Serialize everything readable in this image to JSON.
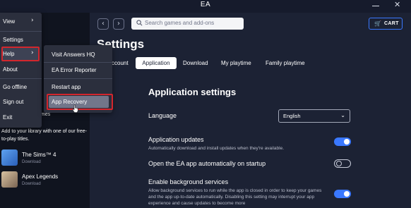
{
  "app": {
    "title": "EA",
    "close_glyph": "✕",
    "back_glyph": "‹",
    "forward_glyph": "›"
  },
  "search": {
    "placeholder": "Search games and add-ons"
  },
  "cart": {
    "label": "CART",
    "icon": "cart-icon",
    "glyph": "🛒"
  },
  "settings": {
    "title": "Settings",
    "tabs": [
      "ccount",
      "Application",
      "Download",
      "My playtime",
      "Family playtime"
    ],
    "active_tab": "Application",
    "section_title": "Application settings",
    "language": {
      "label": "Language",
      "value": "English",
      "arrow": "⌄"
    },
    "rows": [
      {
        "label": "Application updates",
        "description": "Automatically download and install updates when they're available.",
        "enabled": true
      },
      {
        "label": "Open the EA app automatically on startup",
        "description": "",
        "enabled": false
      },
      {
        "label": "Enable background services",
        "description": "Allow background services to run while the app is closed in order to keep your games and the app up-to-date automatically. Disabling this setting may interrupt your app experience and cause updates to become more",
        "enabled": true
      }
    ]
  },
  "menu": {
    "items": [
      {
        "label": "View",
        "has_arrow": true
      },
      {
        "label": "Settings",
        "has_arrow": false
      },
      {
        "label": "Help",
        "has_arrow": true
      },
      {
        "label": "About",
        "has_arrow": false
      },
      {
        "label": "Go offline",
        "has_arrow": false
      },
      {
        "label": "Sign out",
        "has_arrow": false
      },
      {
        "label": "Exit",
        "has_arrow": false
      }
    ],
    "arrow_glyph": "›"
  },
  "help_submenu": {
    "items": [
      {
        "label": "Visit Answers HQ"
      },
      {
        "label": "EA Error Reporter"
      },
      {
        "label": "Restart app"
      },
      {
        "label": "App Recovery"
      }
    ]
  },
  "library": {
    "partial_heading": "mes",
    "promo_text": "Add to your library with one of our free-to-play titles.",
    "games": [
      {
        "name": "The Sims™ 4",
        "action": "Download",
        "thumb_color": "#3b7ad8"
      },
      {
        "name": "Apex Legends",
        "action": "Download",
        "thumb_color": "#b9a083"
      }
    ]
  },
  "colors": {
    "accent": "#3a78ff",
    "highlight_border": "#d3262d",
    "background": "#1c2234",
    "sidebar": "#10141f",
    "menu": "#2b2f3d"
  }
}
